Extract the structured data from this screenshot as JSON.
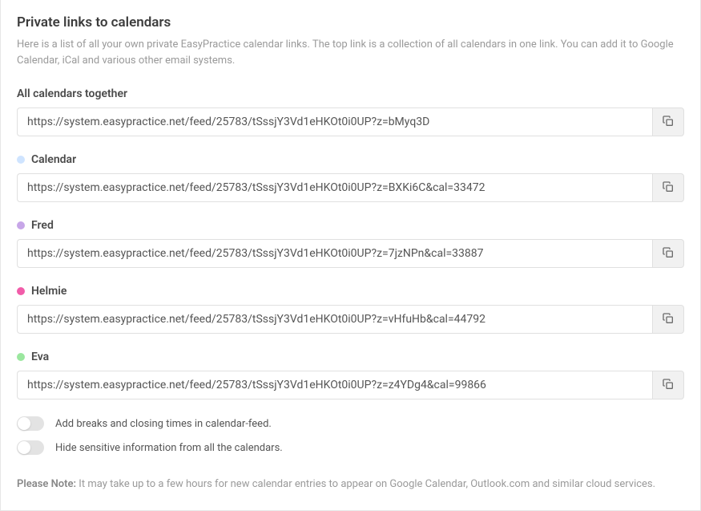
{
  "header": {
    "title": "Private links to calendars",
    "description": "Here is a list of all your own private EasyPractice calendar links. The top link is a collection of all calendars in one link. You can add it to Google Calendar, iCal and various other email systems."
  },
  "calendars": [
    {
      "label": "All calendars together",
      "dot": null,
      "url": "https://system.easypractice.net/feed/25783/tSssjY3Vd1eHKOt0i0UP?z=bMyq3D"
    },
    {
      "label": "Calendar",
      "dot": "#cfe4ff",
      "url": "https://system.easypractice.net/feed/25783/tSssjY3Vd1eHKOt0i0UP?z=BXKi6C&cal=33472"
    },
    {
      "label": "Fred",
      "dot": "#c7a6e8",
      "url": "https://system.easypractice.net/feed/25783/tSssjY3Vd1eHKOt0i0UP?z=7jzNPn&cal=33887"
    },
    {
      "label": "Helmie",
      "dot": "#f15ca9",
      "url": "https://system.easypractice.net/feed/25783/tSssjY3Vd1eHKOt0i0UP?z=vHfuHb&cal=44792"
    },
    {
      "label": "Eva",
      "dot": "#9be79f",
      "url": "https://system.easypractice.net/feed/25783/tSssjY3Vd1eHKOt0i0UP?z=z4YDg4&cal=99866"
    }
  ],
  "toggles": [
    {
      "label": "Add breaks and closing times in calendar-feed.",
      "on": false
    },
    {
      "label": "Hide sensitive information from all the calendars.",
      "on": false
    }
  ],
  "note": {
    "label": "Please Note:",
    "text": " It may take up to a few hours for new calendar entries to appear on Google Calendar, Outlook.com and similar cloud services."
  }
}
